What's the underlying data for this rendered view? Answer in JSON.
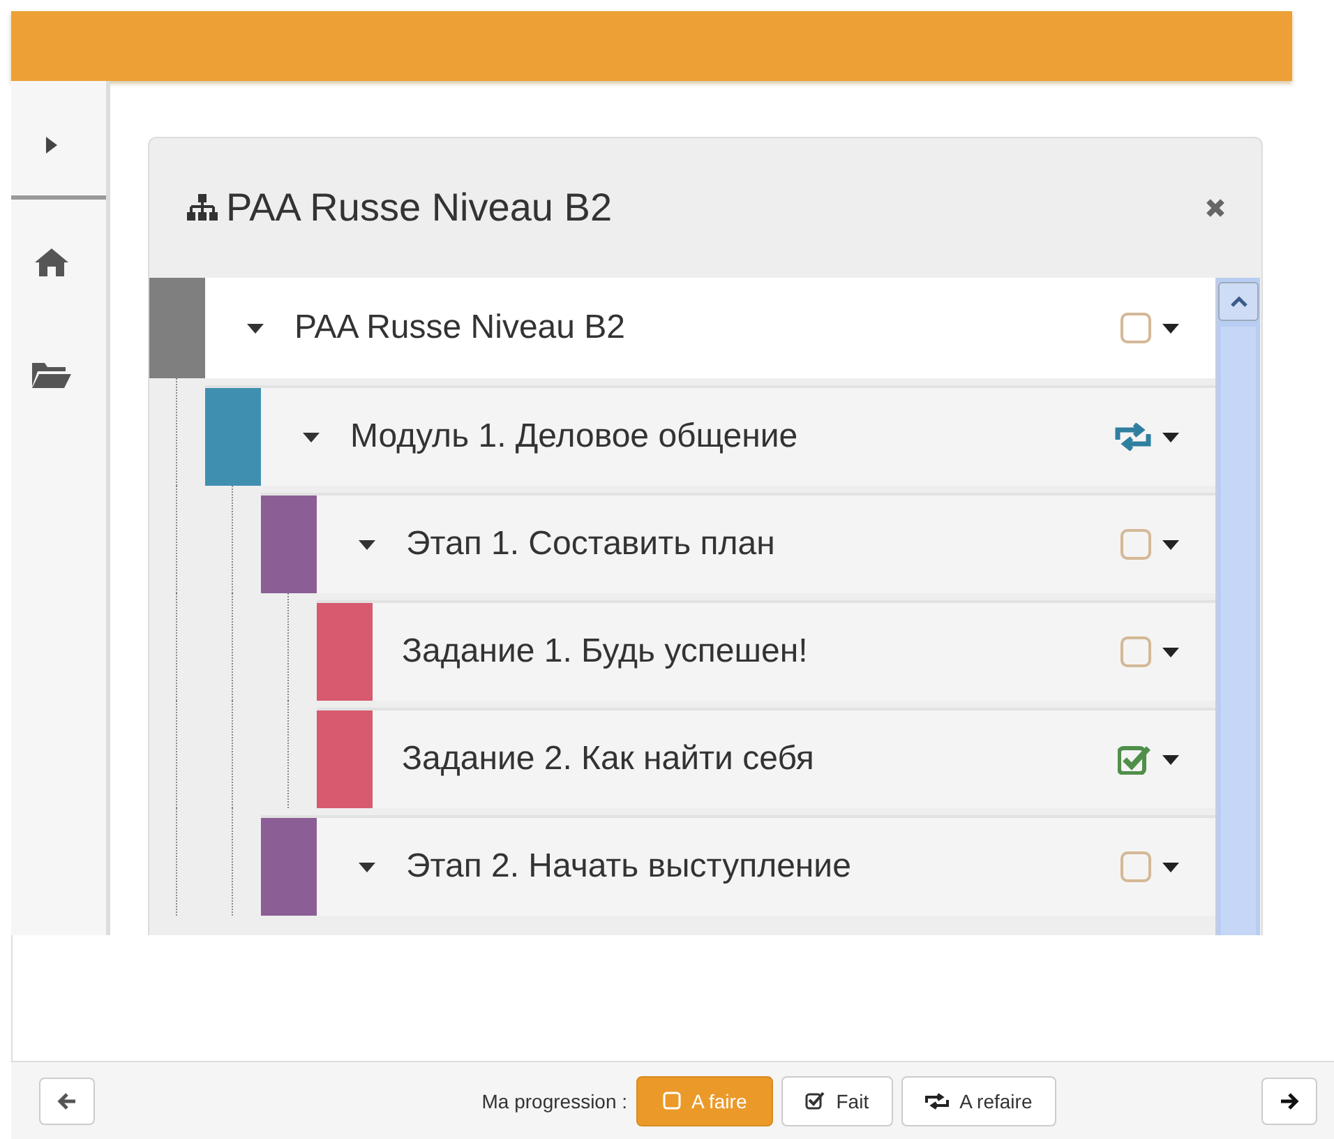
{
  "panel": {
    "title": "PAA Russe Niveau B2"
  },
  "tree": [
    {
      "label": "PAA Russe Niveau B2",
      "color": "#7f7f7f",
      "expanded": true,
      "kind": "todo",
      "selected": true,
      "children": [
        {
          "label": "Модуль 1. Деловое общение",
          "color": "#3f8fb0",
          "expanded": true,
          "kind": "redo",
          "selected": false,
          "children": [
            {
              "label": "Этап 1. Составить план",
              "color": "#8b5e96",
              "expanded": true,
              "kind": "todo",
              "selected": false,
              "children": [
                {
                  "label": "Задание 1. Будь успешен!",
                  "color": "#d75a6e",
                  "kind": "todo",
                  "selected": false
                },
                {
                  "label": "Задание 2. Как найти себя",
                  "color": "#d75a6e",
                  "kind": "done",
                  "selected": false
                }
              ]
            },
            {
              "label": "Этап 2. Начать выступление",
              "color": "#8b5e96",
              "expanded": true,
              "kind": "todo",
              "selected": false
            }
          ]
        }
      ]
    }
  ],
  "footer": {
    "label": "Ma progression :",
    "buttons": [
      {
        "kind": "todo",
        "label": "A faire",
        "selected": true
      },
      {
        "kind": "done",
        "label": "Fait",
        "selected": false
      },
      {
        "kind": "redo",
        "label": "A refaire",
        "selected": false
      }
    ]
  }
}
